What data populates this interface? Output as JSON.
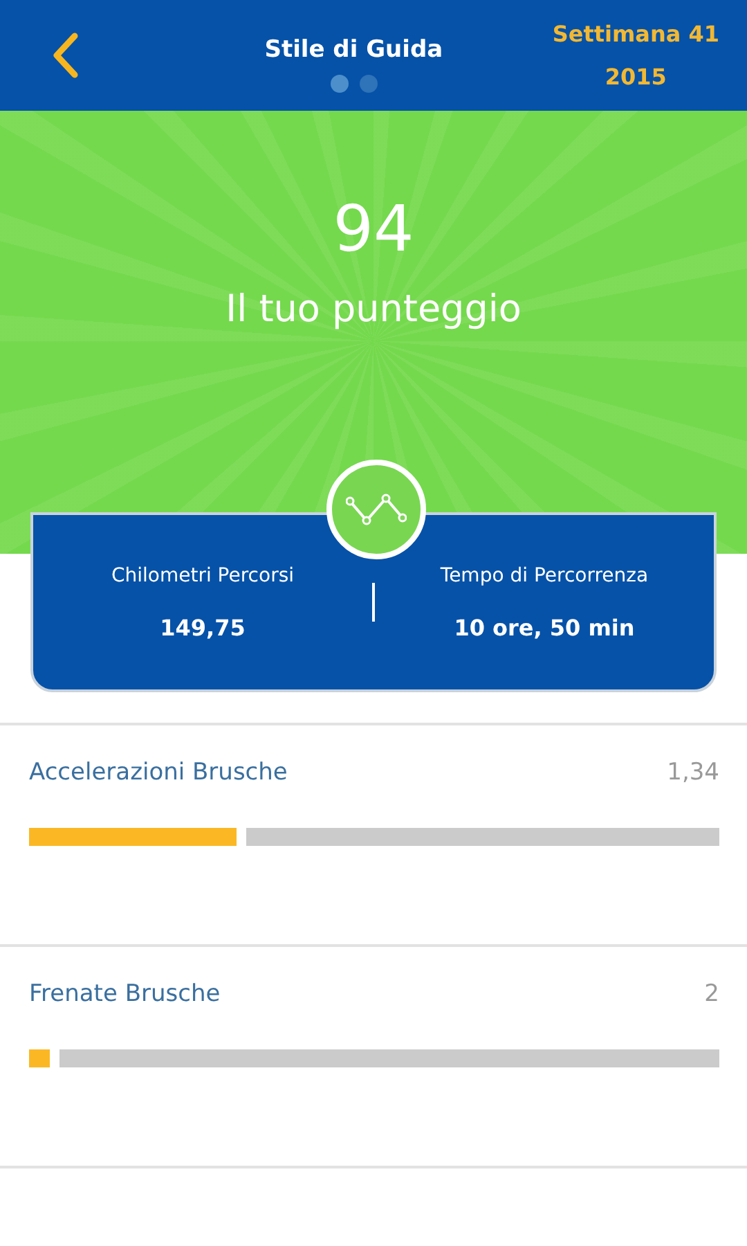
{
  "header": {
    "title": "Stile di Guida",
    "week": "Settimana 41",
    "year": "2015",
    "pages": [
      {
        "selected": true
      },
      {
        "selected": false
      }
    ]
  },
  "score": {
    "value": "94",
    "label": "Il tuo punteggio"
  },
  "summary": [
    {
      "label": "Chilometri Percorsi",
      "value": "149,75"
    },
    {
      "label": "Tempo di Percorrenza",
      "value": "10 ore, 50 min"
    }
  ],
  "metrics": [
    {
      "name": "Accelerazioni Brusche",
      "value": "1,34",
      "level": 0.3
    },
    {
      "name": "Frenate Brusche",
      "value": "2",
      "level": 0.03
    }
  ]
}
